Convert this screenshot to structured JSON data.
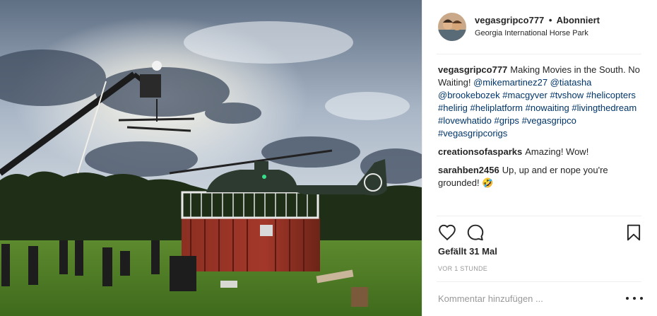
{
  "header": {
    "username": "vegasgripco777",
    "separator": "•",
    "follow_status": "Abonniert",
    "location": "Georgia International Horse Park"
  },
  "comments": [
    {
      "user": "vegasgripco777",
      "segments": [
        {
          "text": "Making Movies in the South. No Waiting! ",
          "link": false
        },
        {
          "text": "@mikemartinez27",
          "link": true
        },
        {
          "text": " ",
          "link": false
        },
        {
          "text": "@tiatasha",
          "link": true
        },
        {
          "text": " ",
          "link": false
        },
        {
          "text": "@brookebozek",
          "link": true
        },
        {
          "text": " ",
          "link": false
        },
        {
          "text": "#macgyver",
          "link": true
        },
        {
          "text": " ",
          "link": false
        },
        {
          "text": "#tvshow",
          "link": true
        },
        {
          "text": " ",
          "link": false
        },
        {
          "text": "#helicopters",
          "link": true
        },
        {
          "text": " ",
          "link": false
        },
        {
          "text": "#helirig",
          "link": true
        },
        {
          "text": " ",
          "link": false
        },
        {
          "text": "#heliplatform",
          "link": true
        },
        {
          "text": " ",
          "link": false
        },
        {
          "text": "#nowaiting",
          "link": true
        },
        {
          "text": " ",
          "link": false
        },
        {
          "text": "#livingthedream",
          "link": true
        },
        {
          "text": " ",
          "link": false
        },
        {
          "text": "#lovewhatido",
          "link": true
        },
        {
          "text": " ",
          "link": false
        },
        {
          "text": "#grips",
          "link": true
        },
        {
          "text": " ",
          "link": false
        },
        {
          "text": "#vegasgripco",
          "link": true
        },
        {
          "text": " ",
          "link": false
        },
        {
          "text": "#vegasgripcorigs",
          "link": true
        }
      ]
    },
    {
      "user": "creationsofasparks",
      "segments": [
        {
          "text": "Amazing! Wow!",
          "link": false
        }
      ]
    },
    {
      "user": "sarahben2456",
      "segments": [
        {
          "text": "Up, up and er nope you're grounded! 🤣",
          "link": false
        }
      ]
    }
  ],
  "actions": {
    "like_icon": "heart-icon",
    "comment_icon": "comment-bubble-icon",
    "save_icon": "bookmark-icon"
  },
  "likes": "Gefällt 31 Mal",
  "timestamp": "VOR 1 STUNDE",
  "comment_input": {
    "placeholder": "Kommentar hinzufügen ...",
    "value": ""
  },
  "more_icon": "more-options-icon",
  "colors": {
    "link": "#003569",
    "text": "#262626",
    "muted": "#999999",
    "divider": "#efefef"
  }
}
